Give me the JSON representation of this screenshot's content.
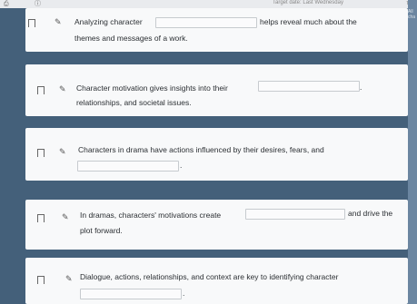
{
  "header": {
    "due_label": "Target date: Last Wednesday",
    "corner_label": "All cha"
  },
  "questions": [
    {
      "before": "Analyzing character",
      "after": "helps reveal much about the",
      "line2": "themes and messages of a work."
    },
    {
      "before": "Character motivation gives insights into their",
      "after": ".",
      "line2": "relationships, and societal issues."
    },
    {
      "before": "Characters in drama have actions influenced by their desires, fears, and",
      "after": "."
    },
    {
      "before": "In dramas, characters' motivations create",
      "after": "and drive the",
      "line2": "plot forward."
    },
    {
      "before": "Dialogue, actions, relationships, and context are key to identifying character",
      "after": "."
    }
  ]
}
